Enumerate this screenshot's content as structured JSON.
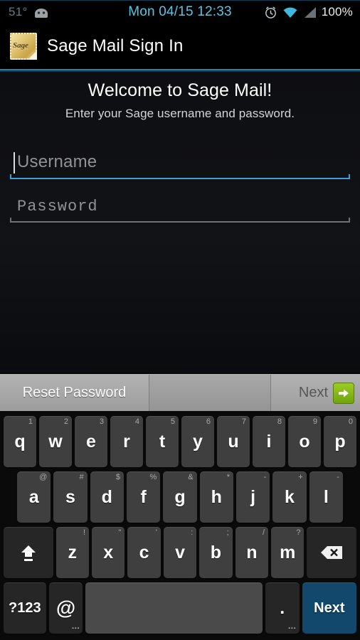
{
  "status_bar": {
    "temperature": "51°",
    "android_icon": "android-head-icon",
    "clock": "Mon 04/15 12:33",
    "alarm_icon": "alarm-clock-icon",
    "wifi_icon": "wifi-icon",
    "signal_icon": "cellular-signal-icon",
    "battery": "100%",
    "clock_color": "#54c7e8",
    "temp_color": "#5c7f8c"
  },
  "action_bar": {
    "app_icon": "sage-stamp-icon",
    "app_icon_word": "Sage",
    "title": "Sage Mail Sign In",
    "accent_color": "#2b7fa8"
  },
  "content": {
    "welcome": "Welcome to Sage Mail!",
    "subtitle": "Enter your Sage username and password.",
    "username_field": {
      "placeholder": "Username",
      "value": "",
      "focused": true,
      "underline_color": "#3aa0d6"
    },
    "password_field": {
      "placeholder": "Password",
      "value": "",
      "focused": false,
      "underline_color": "#6d7174"
    }
  },
  "keyboard": {
    "suggestion_bar": {
      "left_label": "Reset Password",
      "right_label": "Next",
      "right_icon": "green-arrow-right-icon",
      "right_icon_color": "#7cb518"
    },
    "row1": [
      {
        "key": "q",
        "hint": "1"
      },
      {
        "key": "w",
        "hint": "2"
      },
      {
        "key": "e",
        "hint": "3"
      },
      {
        "key": "r",
        "hint": "4"
      },
      {
        "key": "t",
        "hint": "5"
      },
      {
        "key": "y",
        "hint": "6"
      },
      {
        "key": "u",
        "hint": "7"
      },
      {
        "key": "i",
        "hint": "8"
      },
      {
        "key": "o",
        "hint": "9"
      },
      {
        "key": "p",
        "hint": "0"
      }
    ],
    "row2": [
      {
        "key": "a",
        "hint": "@"
      },
      {
        "key": "s",
        "hint": "#"
      },
      {
        "key": "d",
        "hint": "$"
      },
      {
        "key": "f",
        "hint": "%"
      },
      {
        "key": "g",
        "hint": "&"
      },
      {
        "key": "h",
        "hint": "*"
      },
      {
        "key": "j",
        "hint": "-"
      },
      {
        "key": "k",
        "hint": "+"
      },
      {
        "key": "l",
        "hint": "-"
      }
    ],
    "row3": {
      "shift": "shift-key-icon",
      "letters": [
        {
          "key": "z",
          "hint": "!"
        },
        {
          "key": "x",
          "hint": "\""
        },
        {
          "key": "c",
          "hint": "'"
        },
        {
          "key": "v",
          "hint": ":"
        },
        {
          "key": "b",
          "hint": ";"
        },
        {
          "key": "n",
          "hint": "/"
        },
        {
          "key": "m",
          "hint": "?"
        }
      ],
      "delete": "backspace-key-icon"
    },
    "row4": {
      "symbols_label": "?123",
      "at_label": "@",
      "space_label": "",
      "period_label": ".",
      "enter_label": "Next",
      "enter_color": "#11486b"
    }
  }
}
